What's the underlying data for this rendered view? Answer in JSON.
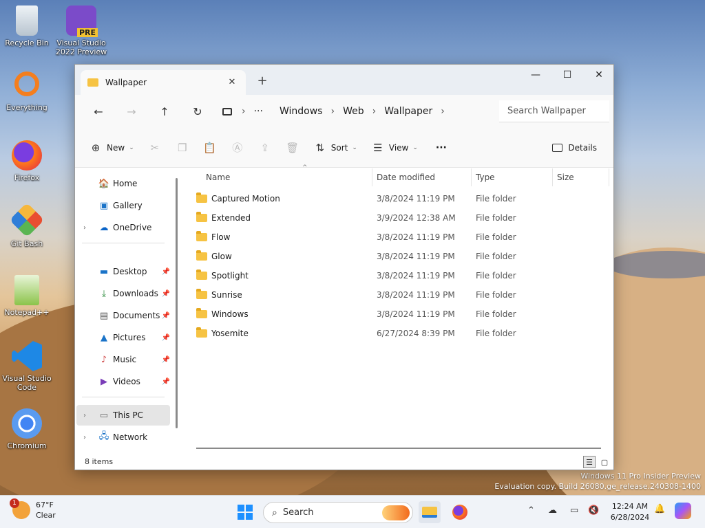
{
  "desktop": {
    "icons": [
      {
        "label": "Recycle Bin",
        "icon": "recycle-bin-icon"
      },
      {
        "label": "Visual Studio 2022 Preview",
        "badge": "PRE",
        "icon": "visual-studio-icon"
      },
      {
        "label": "Everything",
        "icon": "everything-search-icon"
      },
      {
        "label": "Firefox",
        "icon": "firefox-icon"
      },
      {
        "label": "Git Bash",
        "icon": "git-bash-icon"
      },
      {
        "label": "Notepad++",
        "icon": "notepad-plus-plus-icon"
      },
      {
        "label": "Visual Studio Code",
        "icon": "vscode-icon"
      },
      {
        "label": "Chromium",
        "icon": "chromium-icon"
      }
    ],
    "watermark": {
      "line1": "Windows 11 Pro Insider Preview",
      "line2": "Evaluation copy. Build 26080.ge_release.240308-1400"
    }
  },
  "window": {
    "tab_title": "Wallpaper",
    "controls": {
      "minimize": "—",
      "maximize": "☐",
      "close": "✕"
    },
    "address": {
      "overflow": "···",
      "crumbs": [
        "Windows",
        "Web",
        "Wallpaper"
      ]
    },
    "search_placeholder": "Search Wallpaper",
    "commands": {
      "new": "New",
      "sort": "Sort",
      "view": "View",
      "more": "···",
      "details": "Details"
    },
    "nav": {
      "home": "Home",
      "gallery": "Gallery",
      "onedrive": "OneDrive",
      "quick": [
        "Desktop",
        "Downloads",
        "Documents",
        "Pictures",
        "Music",
        "Videos"
      ],
      "this_pc": "This PC",
      "network": "Network"
    },
    "columns": {
      "name": "Name",
      "date": "Date modified",
      "type": "Type",
      "size": "Size"
    },
    "files": [
      {
        "name": "Captured Motion",
        "date": "3/8/2024 11:19 PM",
        "type": "File folder"
      },
      {
        "name": "Extended",
        "date": "3/9/2024 12:38 AM",
        "type": "File folder"
      },
      {
        "name": "Flow",
        "date": "3/8/2024 11:19 PM",
        "type": "File folder"
      },
      {
        "name": "Glow",
        "date": "3/8/2024 11:19 PM",
        "type": "File folder"
      },
      {
        "name": "Spotlight",
        "date": "3/8/2024 11:19 PM",
        "type": "File folder"
      },
      {
        "name": "Sunrise",
        "date": "3/8/2024 11:19 PM",
        "type": "File folder"
      },
      {
        "name": "Windows",
        "date": "3/8/2024 11:19 PM",
        "type": "File folder"
      },
      {
        "name": "Yosemite",
        "date": "6/27/2024 8:39 PM",
        "type": "File folder"
      }
    ],
    "status": "8 items"
  },
  "taskbar": {
    "weather": {
      "temp": "67°F",
      "condition": "Clear",
      "alert": "1"
    },
    "search": "Search",
    "clock": {
      "time": "12:24 AM",
      "date": "6/28/2024"
    }
  },
  "colors": {
    "folder": "#f6c343",
    "accent": "#0067c0"
  }
}
